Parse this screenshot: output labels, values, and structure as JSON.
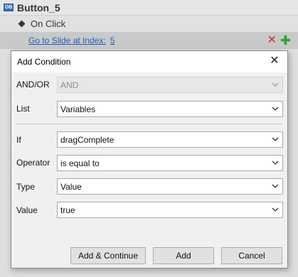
{
  "panel": {
    "object_badge": "OB",
    "object_title": "Button_5",
    "trigger_label": "On Click",
    "action_label": "Go to Slide at Index:",
    "action_value": "5",
    "delete_glyph": "✕",
    "add_glyph": "✚",
    "delete_color": "#d62a2a",
    "add_color": "#2fa32f"
  },
  "dialog": {
    "title": "Add Condition",
    "close_glyph": "✕",
    "fields": {
      "and_or": {
        "label": "AND/OR",
        "value": "AND",
        "disabled": true
      },
      "list": {
        "label": "List",
        "value": "Variables"
      },
      "if": {
        "label": "If",
        "value": "dragComplete"
      },
      "operator": {
        "label": "Operator",
        "value": "is equal to"
      },
      "type": {
        "label": "Type",
        "value": "Value"
      },
      "value": {
        "label": "Value",
        "value": "true"
      }
    },
    "buttons": {
      "add_continue": "Add & Continue",
      "add": "Add",
      "cancel": "Cancel"
    }
  }
}
